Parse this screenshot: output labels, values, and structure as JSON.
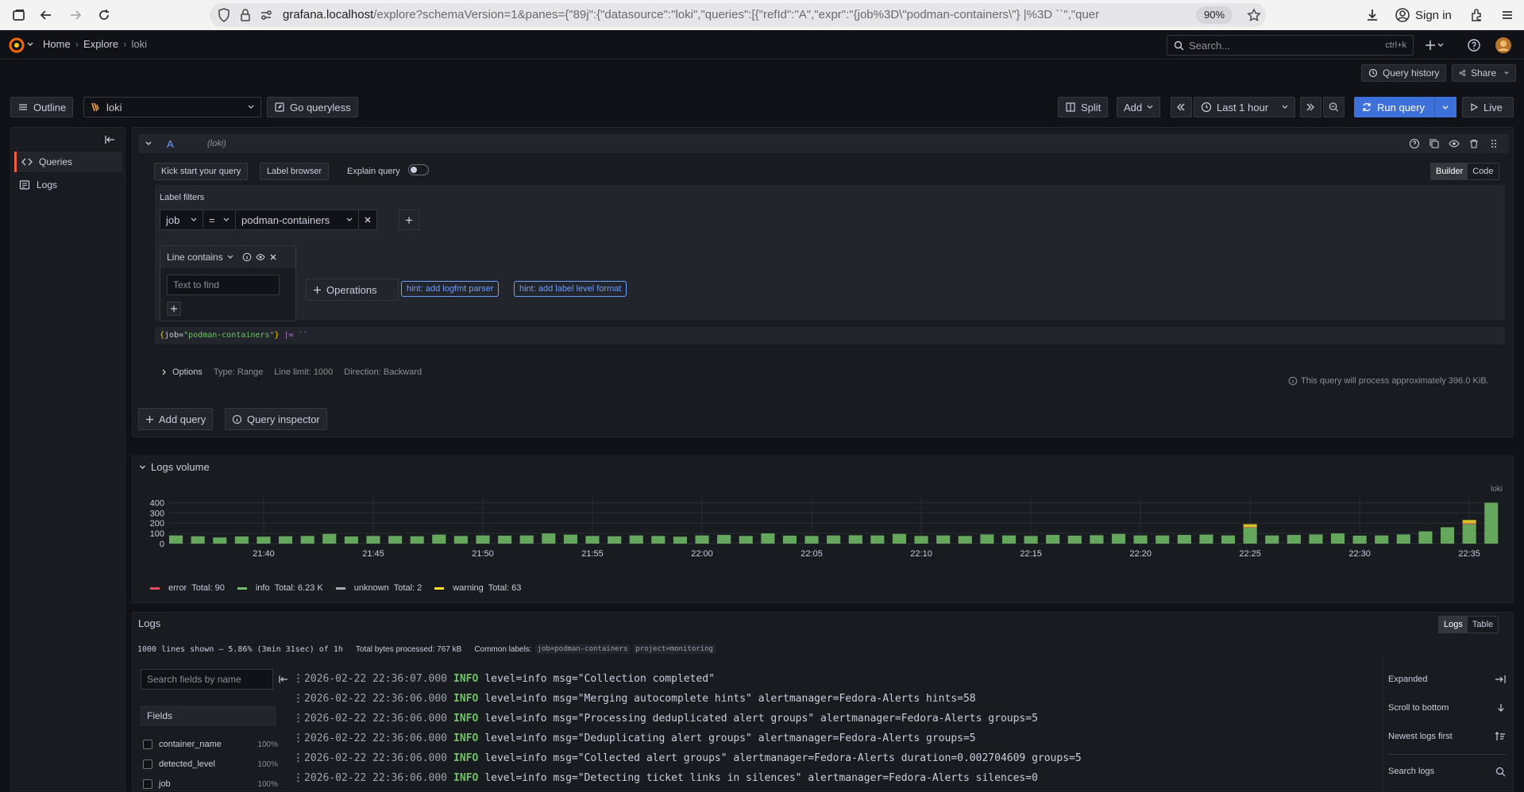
{
  "browser": {
    "url_host": "grafana.localhost",
    "url_rest": "/explore?schemaVersion=1&panes={\"89j\":{\"datasource\":\"loki\",\"queries\":[{\"refId\":\"A\",\"expr\":\"{job%3D\\\"podman-containers\\\"} |%3D ``\",\"quer",
    "zoom": "90%",
    "signin": "Sign in"
  },
  "breadcrumbs": [
    "Home",
    "Explore",
    "loki"
  ],
  "search": {
    "placeholder": "Search...",
    "shortcut": "ctrl+k"
  },
  "secondary": {
    "query_history": "Query history",
    "share": "Share"
  },
  "toolbar": {
    "outline": "Outline",
    "datasource": "loki",
    "go_queryless": "Go queryless",
    "split": "Split",
    "add": "Add",
    "time_range": "Last 1 hour",
    "run_query": "Run query",
    "live": "Live"
  },
  "sidebar": {
    "items": [
      {
        "label": "Queries"
      },
      {
        "label": "Logs"
      }
    ]
  },
  "query": {
    "ref_id": "A",
    "datasource_hint": "(loki)",
    "kick_start": "Kick start your query",
    "label_browser": "Label browser",
    "explain_query": "Explain query",
    "mode_builder": "Builder",
    "mode_code": "Code",
    "label_filters_title": "Label filters",
    "filter_label": "job",
    "filter_op": "=",
    "filter_value": "podman-containers",
    "operation_name": "Line contains",
    "text_placeholder": "Text to find",
    "operations_btn": "Operations",
    "hint1": "hint: add logfmt parser",
    "hint2": "hint: add label level format",
    "expr_part1": "{",
    "expr_key": "job",
    "expr_eq": "=",
    "expr_val": "\"podman-containers\"",
    "expr_part2": "}",
    "expr_pipe": " |= ``",
    "options_label": "Options",
    "opt_type": "Type: Range",
    "opt_limit": "Line limit: 1000",
    "opt_direction": "Direction: Backward",
    "process_note": "This query will process approximately 396.0 KiB.",
    "add_query": "Add query",
    "query_inspector": "Query inspector"
  },
  "volume": {
    "title": "Logs volume",
    "series_label": "loki"
  },
  "chart_data": {
    "type": "bar",
    "stacked": true,
    "ylim": [
      0,
      450
    ],
    "yticks": [
      0,
      100,
      200,
      300,
      400
    ],
    "xticks": [
      "21:40",
      "21:45",
      "21:50",
      "21:55",
      "22:00",
      "22:05",
      "22:10",
      "22:15",
      "22:20",
      "22:25",
      "22:30",
      "22:35"
    ],
    "x_first_minute": "21:36",
    "x_last_minute": "22:36",
    "series": [
      {
        "name": "error",
        "color": "#f2495c",
        "values": [
          0,
          0,
          0,
          0,
          0,
          0,
          0,
          0,
          0,
          0,
          0,
          0,
          0,
          0,
          0,
          0,
          0,
          0,
          0,
          0,
          0,
          0,
          0,
          0,
          0,
          0,
          0,
          0,
          0,
          0,
          0,
          0,
          0,
          0,
          0,
          0,
          0,
          0,
          0,
          0,
          0,
          0,
          0,
          0,
          0,
          0,
          0,
          0,
          0,
          5,
          0,
          0,
          0,
          0,
          0,
          0,
          0,
          0,
          0,
          8,
          0
        ]
      },
      {
        "name": "info",
        "color": "#73bf69",
        "values": [
          80,
          72,
          60,
          70,
          68,
          72,
          75,
          95,
          70,
          75,
          75,
          72,
          88,
          75,
          80,
          78,
          80,
          100,
          88,
          75,
          72,
          80,
          75,
          68,
          80,
          85,
          75,
          100,
          78,
          75,
          80,
          82,
          80,
          95,
          75,
          80,
          75,
          90,
          80,
          75,
          85,
          78,
          82,
          95,
          80,
          80,
          85,
          88,
          80,
          155,
          80,
          85,
          90,
          100,
          78,
          80,
          90,
          120,
          160,
          190,
          400
        ]
      },
      {
        "name": "unknown",
        "color": "#a8a8b3",
        "values": [
          0,
          0,
          0,
          0,
          0,
          0,
          0,
          0,
          0,
          0,
          0,
          0,
          0,
          0,
          0,
          0,
          0,
          0,
          0,
          0,
          0,
          0,
          0,
          0,
          0,
          0,
          0,
          0,
          0,
          0,
          0,
          0,
          0,
          0,
          0,
          0,
          0,
          0,
          0,
          0,
          0,
          0,
          0,
          0,
          0,
          0,
          0,
          0,
          0,
          0,
          0,
          0,
          0,
          0,
          0,
          0,
          0,
          0,
          0,
          0,
          0
        ]
      },
      {
        "name": "warning",
        "color": "#fade2a",
        "values": [
          0,
          0,
          0,
          0,
          0,
          0,
          0,
          0,
          0,
          0,
          0,
          0,
          0,
          0,
          0,
          0,
          0,
          0,
          0,
          0,
          0,
          0,
          0,
          0,
          0,
          0,
          0,
          0,
          0,
          0,
          0,
          0,
          0,
          0,
          0,
          0,
          0,
          0,
          0,
          0,
          0,
          0,
          0,
          0,
          0,
          0,
          0,
          0,
          0,
          30,
          0,
          0,
          0,
          0,
          0,
          0,
          0,
          0,
          0,
          33,
          0
        ]
      }
    ],
    "legend": [
      {
        "name": "error",
        "total": "Total: 90",
        "color": "#f2495c"
      },
      {
        "name": "info",
        "total": "Total: 6.23 K",
        "color": "#73bf69"
      },
      {
        "name": "unknown",
        "total": "Total: 2",
        "color": "#a8a8b3"
      },
      {
        "name": "warning",
        "total": "Total: 63",
        "color": "#fade2a"
      }
    ]
  },
  "logs": {
    "title": "Logs",
    "view_logs": "Logs",
    "view_table": "Table",
    "lines_shown": "1000 lines shown — 5.86% (3min 31sec) of 1h",
    "bytes_processed": "Total bytes processed:  767 kB",
    "common_labels_title": "Common labels:",
    "common_label_1": "job=podman-containers",
    "common_label_2": "project=monitoring",
    "search_fields_placeholder": "Search fields by name",
    "fields_title": "Fields",
    "fields": [
      {
        "name": "container_name",
        "pct": "100%"
      },
      {
        "name": "detected_level",
        "pct": "100%"
      },
      {
        "name": "job",
        "pct": "100%"
      }
    ],
    "lines": [
      {
        "ts": "2026-02-22 22:36:07.000",
        "level": "INFO",
        "body": "level=info msg=\"Collection completed\""
      },
      {
        "ts": "2026-02-22 22:36:06.000",
        "level": "INFO",
        "body": "level=info msg=\"Merging autocomplete hints\" alertmanager=Fedora-Alerts hints=58"
      },
      {
        "ts": "2026-02-22 22:36:06.000",
        "level": "INFO",
        "body": "level=info msg=\"Processing deduplicated alert groups\" alertmanager=Fedora-Alerts groups=5"
      },
      {
        "ts": "2026-02-22 22:36:06.000",
        "level": "INFO",
        "body": "level=info msg=\"Deduplicating alert groups\" alertmanager=Fedora-Alerts groups=5"
      },
      {
        "ts": "2026-02-22 22:36:06.000",
        "level": "INFO",
        "body": "level=info msg=\"Collected alert groups\" alertmanager=Fedora-Alerts duration=0.002704609 groups=5"
      },
      {
        "ts": "2026-02-22 22:36:06.000",
        "level": "INFO",
        "body": "level=info msg=\"Detecting ticket links in silences\" alertmanager=Fedora-Alerts silences=0"
      }
    ],
    "right_options": [
      {
        "label": "Expanded"
      },
      {
        "label": "Scroll to bottom"
      },
      {
        "label": "Newest logs first"
      },
      {
        "label": "Search logs"
      }
    ]
  }
}
